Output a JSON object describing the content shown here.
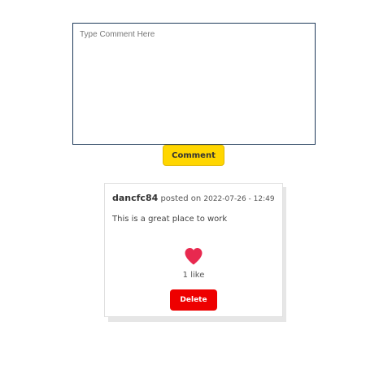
{
  "comment_form": {
    "placeholder": "Type Comment Here",
    "value": "",
    "submit_label": "Comment"
  },
  "post": {
    "author": "dancfc84",
    "posted_label": "posted on",
    "date": "2022-07-26 - 12:49",
    "body": "This is a great place to work",
    "like_icon": "heart-icon",
    "like_count_label": "1 like",
    "delete_label": "Delete"
  },
  "colors": {
    "comment_button": "#ffd600",
    "delete_button": "#ee0000",
    "heart": "#e8294f",
    "textarea_border": "#1f3a5a"
  }
}
